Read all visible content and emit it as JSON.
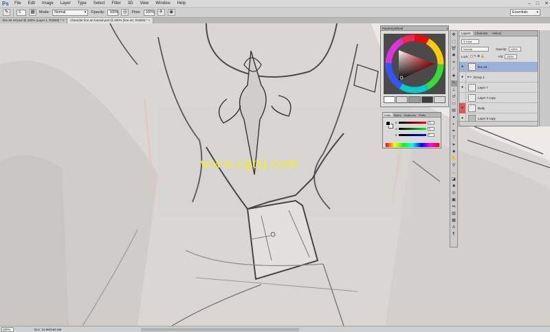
{
  "app": {
    "logo": "Ps"
  },
  "menu": [
    "File",
    "Edit",
    "Image",
    "Layer",
    "Type",
    "Select",
    "Filter",
    "3D",
    "View",
    "Window",
    "Help"
  ],
  "window_controls": [
    "–",
    "□",
    "✕"
  ],
  "options": {
    "brush_size": "3",
    "mode_label": "Mode:",
    "mode_value": "Normal",
    "opacity_label": "Opacity:",
    "opacity_value": "100%",
    "flow_label": "Flow:",
    "flow_value": "100%",
    "workspace": "Essentials"
  },
  "doc_tabs": [
    {
      "label": "line art ref.psd @ 200% (Layer 1, RGB/8) *",
      "active": false
    },
    {
      "label": "character line art tutorial.psd @ 200% (line art, RGB/8) *",
      "active": true
    }
  ],
  "watermark": "www.cgtsj.com",
  "status": {
    "zoom": "200%",
    "doc_size": "Doc: 24.9M/196.5M"
  },
  "wheel_panel": {
    "title": "PainterlyWheel"
  },
  "color_panel": {
    "tabs": [
      "Color",
      "Styles",
      "Swatches",
      "Paths"
    ],
    "sliders": [
      {
        "label": "R",
        "value": "0"
      },
      {
        "label": "G",
        "value": "0"
      },
      {
        "label": "B",
        "value": "0"
      }
    ]
  },
  "layers_panel": {
    "tabs": [
      "Layers",
      "Channels",
      "History"
    ],
    "kind_label": "Kind",
    "blend_mode": "Normal",
    "opacity_label": "Opacity:",
    "opacity_value": "100%",
    "lock_label": "Lock:",
    "fill_label": "Fill:",
    "fill_value": "100%",
    "layers": [
      {
        "name": "line art",
        "selected": true,
        "eye": "●",
        "red": false
      },
      {
        "name": "Group 1",
        "selected": false,
        "eye": "●",
        "red": false
      },
      {
        "name": "Layer 7",
        "selected": false,
        "eye": "●",
        "red": false
      },
      {
        "name": "Layer 7 copy",
        "selected": false,
        "eye": "",
        "red": false
      },
      {
        "name": "Body",
        "selected": false,
        "eye": "●",
        "red": true
      },
      {
        "name": "Layer 8 copy",
        "selected": false,
        "eye": "●",
        "red": false
      }
    ]
  },
  "tools": [
    "move-icon",
    "marquee-icon",
    "lasso-icon",
    "quick-select-icon",
    "crop-icon",
    "eyedropper-icon",
    "healing-icon",
    "brush-icon",
    "stamp-icon",
    "history-brush-icon",
    "eraser-icon",
    "gradient-icon",
    "blur-icon",
    "dodge-icon",
    "pen-icon",
    "type-icon",
    "path-select-icon",
    "shape-icon",
    "hand-icon",
    "zoom-icon"
  ],
  "colors": {
    "accent": "#9cb0d6",
    "canvas": "#ece9e7",
    "watermark": "#f5ee1f"
  }
}
